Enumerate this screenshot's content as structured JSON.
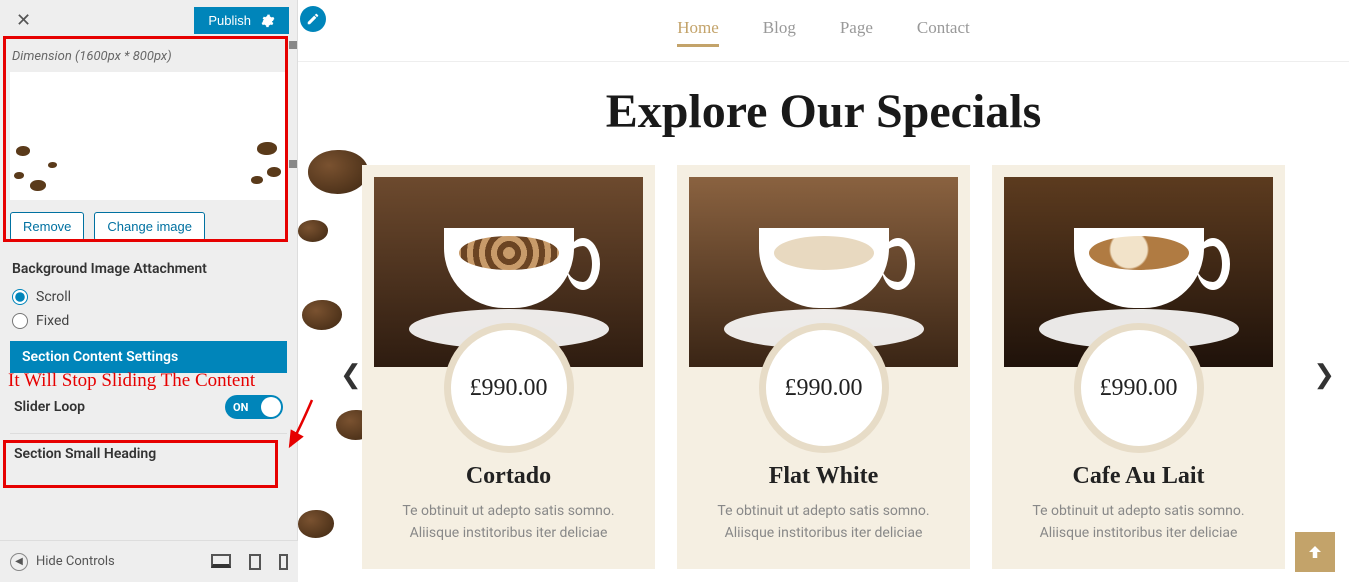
{
  "sidebar": {
    "publish_label": "Publish",
    "dimension_hint": "Dimension (1600px * 800px)",
    "remove_label": "Remove",
    "change_image_label": "Change image",
    "bg_attachment_heading": "Background Image Attachment",
    "bg_attachment_options": {
      "scroll": "Scroll",
      "fixed": "Fixed"
    },
    "section_bar_label": "Section Content Settings",
    "slider_loop_label": "Slider Loop",
    "slider_loop_state": "ON",
    "accordion_small_heading": "Section Small Heading",
    "hide_controls_label": "Hide Controls"
  },
  "annotation": {
    "text": "It Will Stop Sliding The Content"
  },
  "nav": {
    "items": [
      {
        "label": "Home",
        "active": true
      },
      {
        "label": "Blog",
        "active": false
      },
      {
        "label": "Page",
        "active": false
      },
      {
        "label": "Contact",
        "active": false
      }
    ]
  },
  "hero": {
    "title": "Explore Our Specials"
  },
  "cards": [
    {
      "price": "£990.00",
      "name": "Cortado",
      "desc": "Te obtinuit ut adepto satis somno. Aliisque institoribus iter deliciae"
    },
    {
      "price": "£990.00",
      "name": "Flat White",
      "desc": "Te obtinuit ut adepto satis somno. Aliisque institoribus iter deliciae"
    },
    {
      "price": "£990.00",
      "name": "Cafe Au Lait",
      "desc": "Te obtinuit ut adepto satis somno. Aliisque institoribus iter deliciae"
    }
  ]
}
